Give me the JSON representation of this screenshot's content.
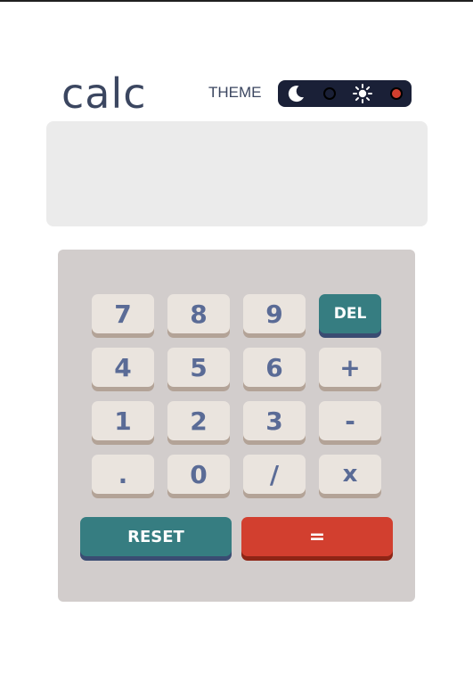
{
  "header": {
    "logo": "calc",
    "theme_label": "THEME"
  },
  "theme_toggle": {
    "options": [
      "dark",
      "light"
    ],
    "selected": "light",
    "accent": "#d23f2f"
  },
  "display": {
    "value": ""
  },
  "keys": {
    "k7": "7",
    "k8": "8",
    "k9": "9",
    "del": "DEL",
    "k4": "4",
    "k5": "5",
    "k6": "6",
    "plus": "+",
    "k1": "1",
    "k2": "2",
    "k3": "3",
    "minus": "-",
    "dot": ".",
    "k0": "0",
    "divide": "/",
    "multiply": "x",
    "reset": "RESET",
    "equals": "="
  },
  "colors": {
    "key_bg": "#eae4de",
    "key_text": "#5a6b96",
    "accent_teal": "#367d81",
    "accent_red": "#d23f2f",
    "keypad_bg": "#d2cdcc",
    "screen_bg": "#ebebeb"
  }
}
